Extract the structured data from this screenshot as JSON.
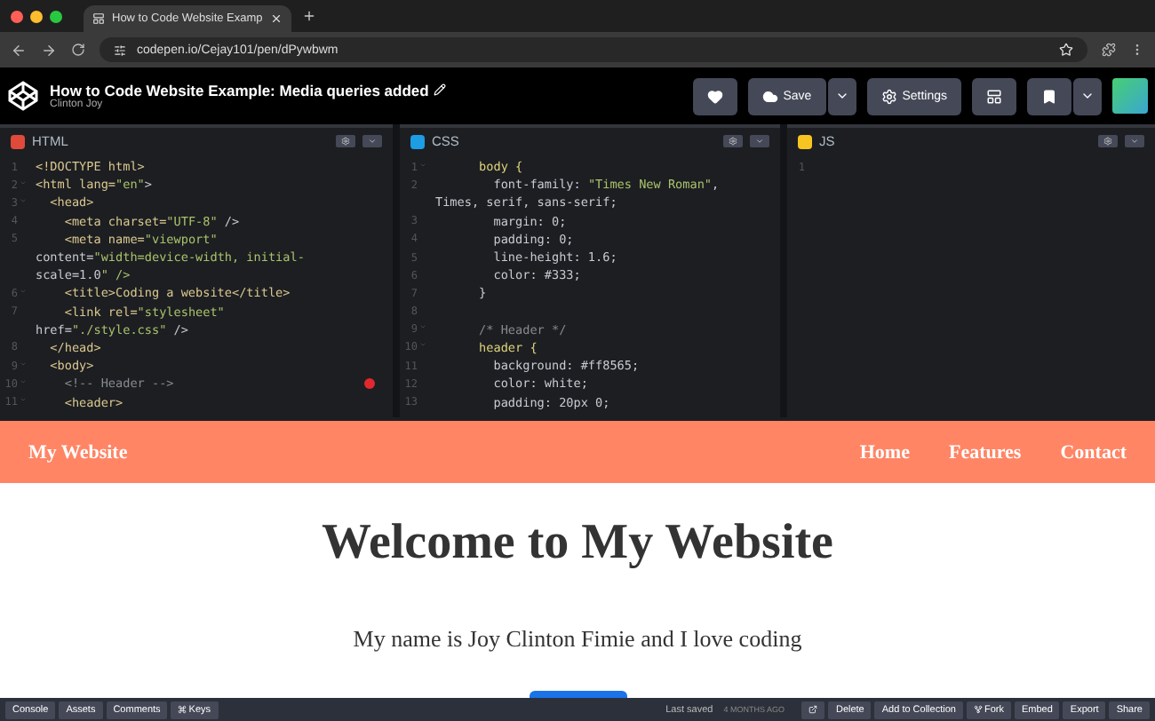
{
  "browser": {
    "tab": {
      "title": "How to Code Website Examp",
      "selected": true
    },
    "url": "codepen.io/Cejay101/pen/dPywbwm"
  },
  "pen": {
    "title": "How to Code Website Example: Media queries added",
    "author": "Clinton Joy",
    "buttons": [
      {
        "kind": "heart"
      },
      {
        "kind": "save",
        "label": "Save"
      },
      {
        "kind": "settings",
        "label": "Settings"
      },
      {
        "kind": "layout"
      },
      {
        "kind": "bookmark"
      }
    ]
  },
  "editors": [
    {
      "kind": "html",
      "title": "HTML",
      "lines": [
        {
          "number": "1",
          "fold": false,
          "text": "<!DOCTYPE html>"
        },
        {
          "number": "2",
          "fold": true,
          "text": "<html lang=\"en\">"
        },
        {
          "number": "3",
          "fold": true,
          "text": "  <head>"
        },
        {
          "number": "4",
          "fold": false,
          "text": "    <meta charset=\"UTF-8\" />"
        },
        {
          "number": "5",
          "fold": false,
          "text": "    <meta name=\"viewport\""
        },
        {
          "text": "content=\"width=device-width, initial-"
        },
        {
          "text": "scale=1.0\" />"
        },
        {
          "number": "6",
          "fold": true,
          "text": "    <title>Coding a website</title>"
        },
        {
          "number": "7",
          "fold": false,
          "text": "    <link rel=\"stylesheet\""
        },
        {
          "text": "href=\"./style.css\" />"
        },
        {
          "number": "8",
          "fold": false,
          "text": "  </head>"
        },
        {
          "number": "9",
          "fold": true,
          "text": "  <body>"
        },
        {
          "number": "10",
          "fold": true,
          "text": "    <!-- Header -->",
          "error": true
        },
        {
          "number": "11",
          "fold": true,
          "text": "    <header>"
        }
      ]
    },
    {
      "kind": "css",
      "title": "CSS",
      "lines": [
        {
          "number": "1",
          "fold": true,
          "text": "      body {"
        },
        {
          "number": "2",
          "fold": false,
          "text": "        font-family: \"Times New Roman\","
        },
        {
          "text": "Times, serif, sans-serif;"
        },
        {
          "number": "3",
          "fold": false,
          "text": "        margin: 0;"
        },
        {
          "number": "4",
          "fold": false,
          "text": "        padding: 0;"
        },
        {
          "number": "5",
          "fold": false,
          "text": "        line-height: 1.6;"
        },
        {
          "number": "6",
          "fold": false,
          "text": "        color: #333;"
        },
        {
          "number": "7",
          "fold": false,
          "text": "      }"
        },
        {
          "number": "8",
          "fold": false
        },
        {
          "number": "9",
          "fold": true,
          "text": "      /* Header */"
        },
        {
          "number": "10",
          "fold": true,
          "text": "      header {"
        },
        {
          "number": "11",
          "fold": false,
          "text": "        background: #ff8565;"
        },
        {
          "number": "12",
          "fold": false,
          "text": "        color: white;"
        },
        {
          "number": "13",
          "fold": false,
          "text": "        padding: 20px 0;"
        }
      ]
    },
    {
      "kind": "js",
      "title": "JS",
      "lines": [
        {
          "number": "1",
          "fold": false
        }
      ]
    }
  ],
  "preview": {
    "brand": "My Website",
    "nav": [
      "Home",
      "Features",
      "Contact"
    ],
    "heading": "Welcome to My Website",
    "paragraph": "My name is Joy Clinton Fimie and I love coding"
  },
  "footer": {
    "left": [
      {
        "kind": "plain",
        "label": "Console"
      },
      {
        "kind": "plain",
        "label": "Assets"
      },
      {
        "kind": "plain",
        "label": "Comments"
      },
      {
        "kind": "keys",
        "label": "Keys"
      }
    ],
    "saved_label": "Last saved",
    "saved_time": "4 MONTHS AGO",
    "right": [
      {
        "kind": "external"
      },
      {
        "kind": "plain",
        "label": "Delete"
      },
      {
        "kind": "plain",
        "label": "Add to Collection"
      },
      {
        "kind": "fork",
        "label": "Fork"
      },
      {
        "kind": "plain",
        "label": "Embed"
      },
      {
        "kind": "plain",
        "label": "Export"
      },
      {
        "kind": "plain",
        "label": "Share"
      }
    ]
  }
}
